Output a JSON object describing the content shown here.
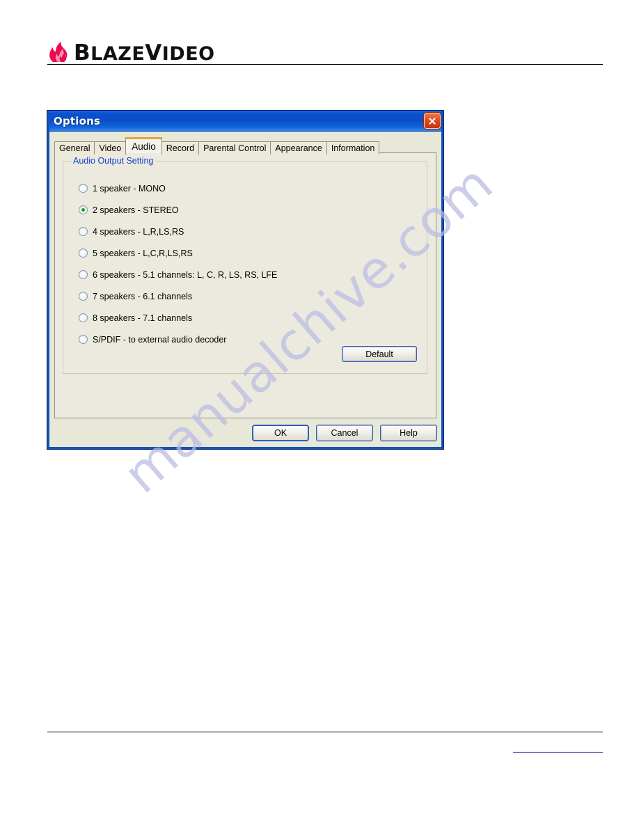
{
  "header": {
    "brand_prefix": "B",
    "brand_name_1": "LAZE",
    "brand_prefix_2": "V",
    "brand_name_2": "IDEO",
    "logo_icon": "flame-icon",
    "logo_color": "#ec0a4f"
  },
  "watermark": {
    "text": "manualchive.com",
    "color": "#b9bbe4"
  },
  "dialog": {
    "title": "Options",
    "close_icon": "close-x-icon",
    "titlebar_color": "#0a4dc8",
    "tabs": [
      {
        "label": "General",
        "active": false
      },
      {
        "label": "Video",
        "active": false
      },
      {
        "label": "Audio",
        "active": true
      },
      {
        "label": "Record",
        "active": false
      },
      {
        "label": "Parental Control",
        "active": false
      },
      {
        "label": "Appearance",
        "active": false
      },
      {
        "label": "Information",
        "active": false
      }
    ],
    "active_tab_accent": "#e8a33d",
    "groupbox": {
      "title": "Audio Output Setting",
      "title_color": "#1542c8",
      "options": [
        {
          "label": "1 speaker - MONO",
          "checked": false
        },
        {
          "label": "2 speakers - STEREO",
          "checked": true
        },
        {
          "label": "4 speakers - L,R,LS,RS",
          "checked": false
        },
        {
          "label": "5 speakers - L,C,R,LS,RS",
          "checked": false
        },
        {
          "label": "6 speakers - 5.1 channels: L, C, R, LS, RS, LFE",
          "checked": false
        },
        {
          "label": "7 speakers - 6.1 channels",
          "checked": false
        },
        {
          "label": "8 speakers - 7.1 channels",
          "checked": false
        },
        {
          "label": "S/PDIF - to external audio decoder",
          "checked": false
        }
      ],
      "selected_dot_color": "#1a9e1a",
      "default_button": "Default"
    },
    "footer_buttons": {
      "ok": "OK",
      "cancel": "Cancel",
      "help": "Help"
    }
  }
}
